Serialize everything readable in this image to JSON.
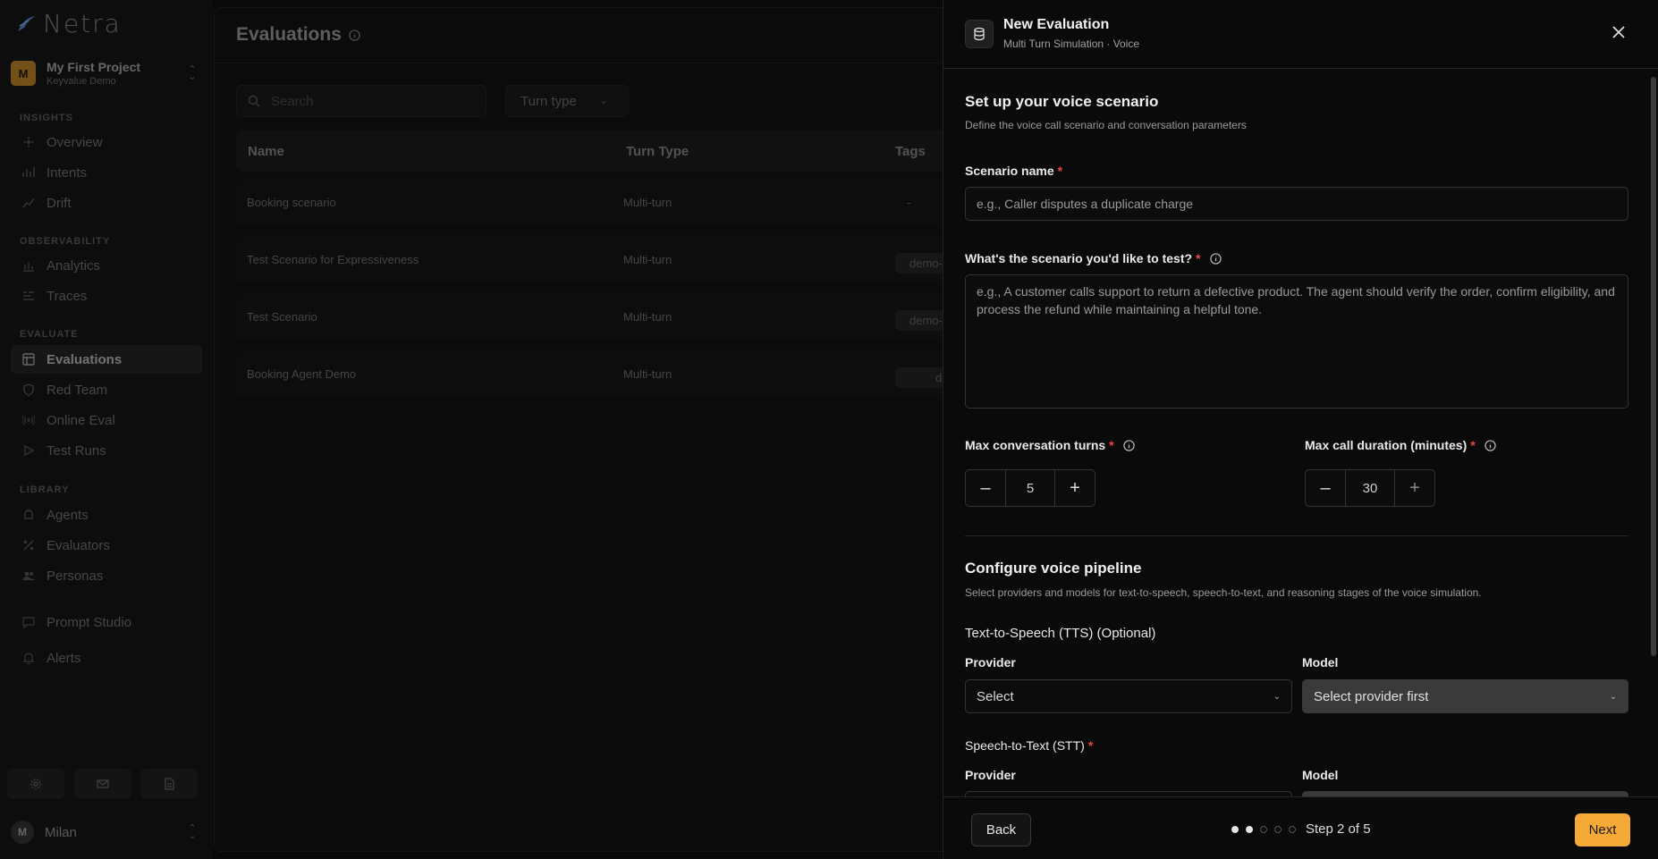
{
  "app": {
    "name": "Netra"
  },
  "project": {
    "avatar": "M",
    "name": "My First Project",
    "org": "Keyvalue Demo"
  },
  "sidebar": {
    "sections": [
      {
        "label": "INSIGHTS"
      },
      {
        "label": "OBSERVABILITY"
      },
      {
        "label": "EVALUATE"
      },
      {
        "label": "LIBRARY"
      }
    ],
    "items": [
      {
        "label": "Overview",
        "icon": "overview-icon"
      },
      {
        "label": "Intents",
        "icon": "intents-icon"
      },
      {
        "label": "Drift",
        "icon": "drift-icon"
      },
      {
        "label": "Analytics",
        "icon": "analytics-icon"
      },
      {
        "label": "Traces",
        "icon": "traces-icon"
      },
      {
        "label": "Evaluations",
        "icon": "grid-icon",
        "active": true
      },
      {
        "label": "Red Team",
        "icon": "shield-icon"
      },
      {
        "label": "Online Eval",
        "icon": "broadcast-icon"
      },
      {
        "label": "Test Runs",
        "icon": "play-icon"
      },
      {
        "label": "Agents",
        "icon": "agent-icon"
      },
      {
        "label": "Evaluators",
        "icon": "percent-icon"
      },
      {
        "label": "Personas",
        "icon": "users-icon"
      },
      {
        "label": "Prompt Studio",
        "icon": "chat-icon"
      },
      {
        "label": "Alerts",
        "icon": "bell-icon"
      }
    ]
  },
  "user": {
    "avatar": "M",
    "name": "Milan"
  },
  "main": {
    "title": "Evaluations",
    "search_placeholder": "Search",
    "turn_filter": "Turn type",
    "columns": [
      "Name",
      "Turn Type",
      "Tags"
    ],
    "rows": [
      {
        "name": "Booking scenario",
        "turn": "Multi-turn",
        "tag": "-"
      },
      {
        "name": "Test Scenario for Expressiveness",
        "turn": "Multi-turn",
        "tag": "demo-"
      },
      {
        "name": "Test Scenario",
        "turn": "Multi-turn",
        "tag": "demo-"
      },
      {
        "name": "Booking Agent Demo",
        "turn": "Multi-turn",
        "tag": "d"
      }
    ]
  },
  "drawer": {
    "title": "New Evaluation",
    "subtitle": "Multi Turn Simulation · Voice",
    "scenario": {
      "title": "Set up your voice scenario",
      "desc": "Define the voice call scenario and conversation parameters",
      "name_label": "Scenario name",
      "name_placeholder": "e.g., Caller disputes a duplicate charge",
      "test_label": "What's the scenario you'd like to test?",
      "test_placeholder": "e.g., A customer calls support to return a defective product. The agent should verify the order, confirm eligibility, and process the refund while maintaining a helpful tone.",
      "turns_label": "Max conversation turns",
      "turns_value": "5",
      "duration_label": "Max call duration (minutes)",
      "duration_value": "30"
    },
    "pipeline": {
      "title": "Configure voice pipeline",
      "desc": "Select providers and models for text-to-speech, speech-to-text, and reasoning stages of the voice simulation.",
      "tts_title": "Text-to-Speech (TTS) (Optional)",
      "provider_label": "Provider",
      "model_label": "Model",
      "provider_placeholder": "Select",
      "model_placeholder": "Select provider first",
      "stt_title": "Speech-to-Text (STT)"
    },
    "footer": {
      "back": "Back",
      "step": "Step 2 of 5",
      "next": "Next",
      "total_steps": 5,
      "current_step": 2
    },
    "colors": {
      "accent": "#f5a936",
      "required": "#ef4444"
    }
  }
}
